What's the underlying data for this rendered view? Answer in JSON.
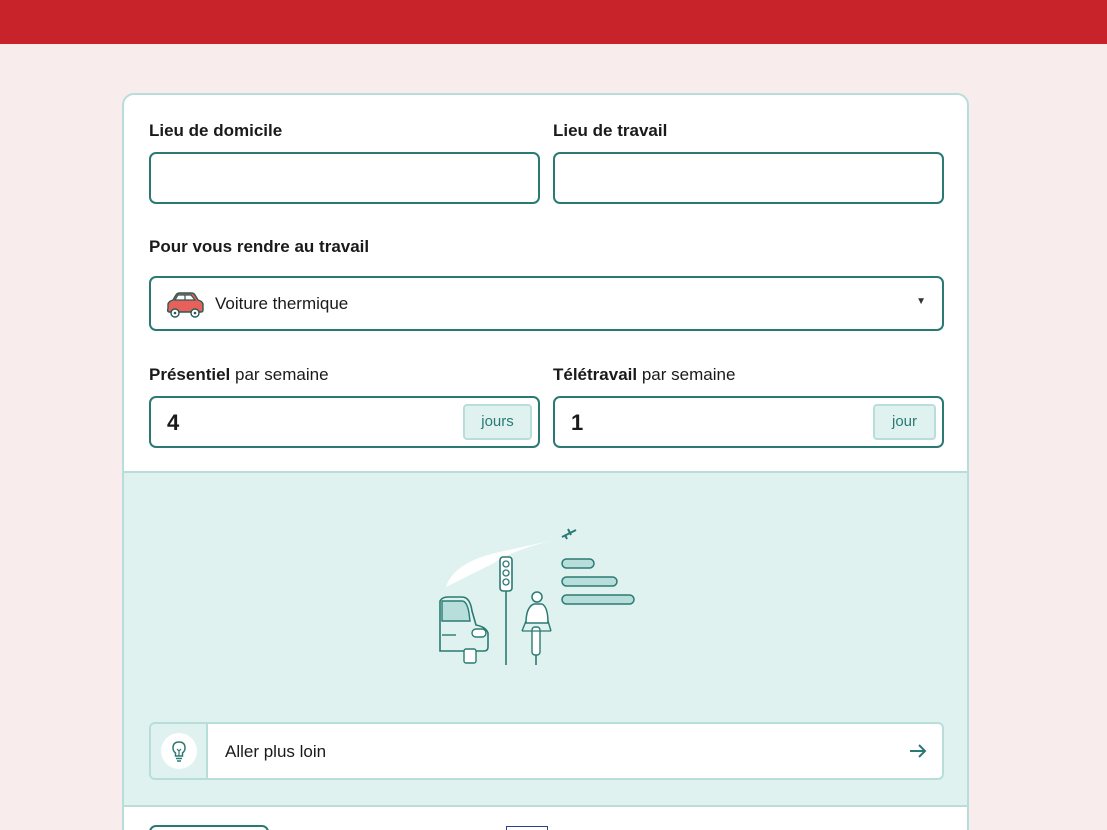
{
  "form": {
    "home_label": "Lieu de domicile",
    "home_value": "",
    "work_label": "Lieu de travail",
    "work_value": "",
    "transport_label": "Pour vous rendre au travail",
    "transport_selected": "Voiture thermique",
    "transport_icon": "car-icon",
    "onsite_label_bold": "Présentiel",
    "onsite_label_rest": "par semaine",
    "onsite_value": "4",
    "onsite_unit": "jours",
    "remote_label_bold": "Télétravail",
    "remote_label_rest": "par semaine",
    "remote_value": "1",
    "remote_unit": "jour"
  },
  "further": {
    "label": "Aller plus loin",
    "icon": "lightbulb-icon",
    "arrow_icon": "arrow-right-icon"
  },
  "colors": {
    "topbar": "#c8222a",
    "background": "#f9eced",
    "accent": "#2a7a73",
    "accent_light": "#dff2f0",
    "border_light": "#b8dedb"
  }
}
